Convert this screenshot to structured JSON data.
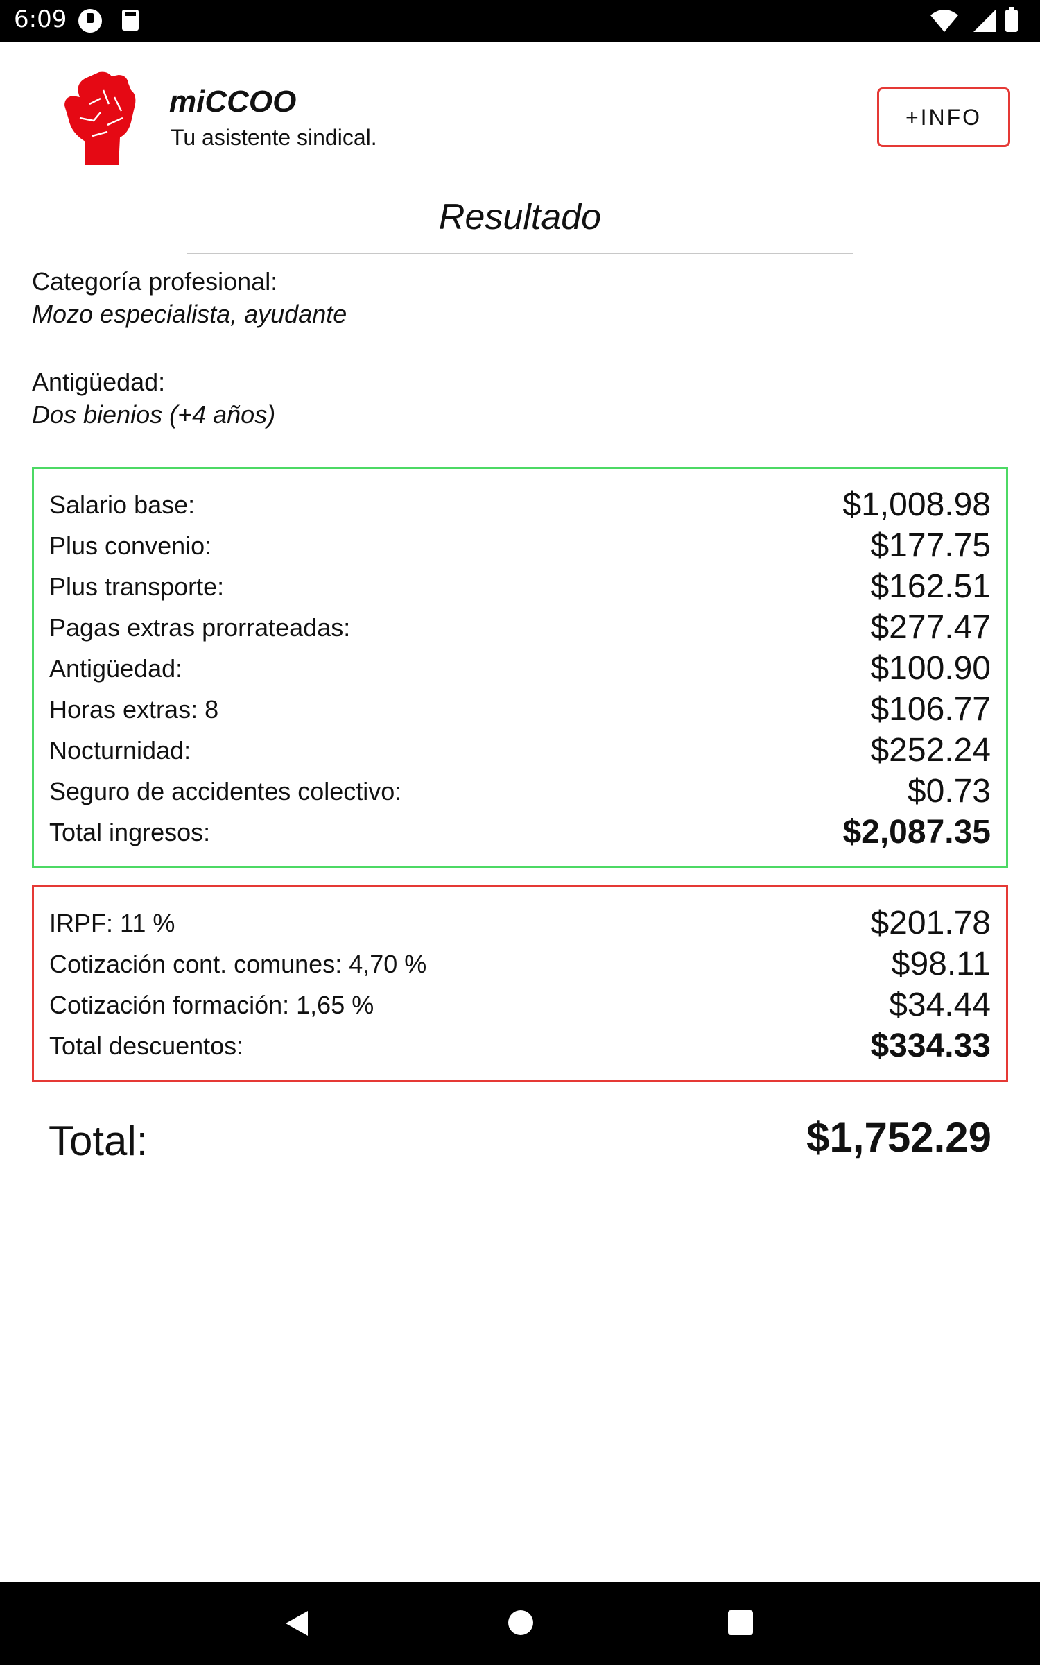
{
  "status_bar": {
    "time": "6:09"
  },
  "header": {
    "app_title": "miCCOO",
    "app_subtitle": "Tu asistente sindical.",
    "info_button": "+INFO"
  },
  "result": {
    "title": "Resultado",
    "category_label": "Categoría profesional:",
    "category_value": "Mozo especialista, ayudante",
    "seniority_label": "Antigüedad:",
    "seniority_value": "Dos bienios (+4 años)"
  },
  "income": [
    {
      "label": "Salario base:",
      "value": "$1,008.98"
    },
    {
      "label": "Plus convenio:",
      "value": "$177.75"
    },
    {
      "label": "Plus transporte:",
      "value": "$162.51"
    },
    {
      "label": "Pagas extras prorrateadas:",
      "value": "$277.47"
    },
    {
      "label": "Antigüedad:",
      "value": "$100.90"
    },
    {
      "label": "Horas extras: 8",
      "value": "$106.77"
    },
    {
      "label": "Nocturnidad:",
      "value": "$252.24"
    },
    {
      "label": "Seguro de accidentes colectivo:",
      "value": "$0.73"
    },
    {
      "label": "Total ingresos:",
      "value": "$2,087.35"
    }
  ],
  "deductions": [
    {
      "label": "IRPF: 11 %",
      "value": "$201.78"
    },
    {
      "label": "Cotización cont. comunes: 4,70 %",
      "value": "$98.11"
    },
    {
      "label": "Cotización formación: 1,65 %",
      "value": "$34.44"
    },
    {
      "label": "Total descuentos:",
      "value": "$334.33"
    }
  ],
  "total": {
    "label": "Total:",
    "value": "$1,752.29"
  },
  "colors": {
    "income_border": "#4cd964",
    "deduction_border": "#e53935",
    "accent": "#e53935"
  },
  "icons": [
    "raised-fist-logo",
    "wifi-icon",
    "signal-icon",
    "battery-icon",
    "back-icon",
    "home-icon",
    "recents-icon"
  ]
}
